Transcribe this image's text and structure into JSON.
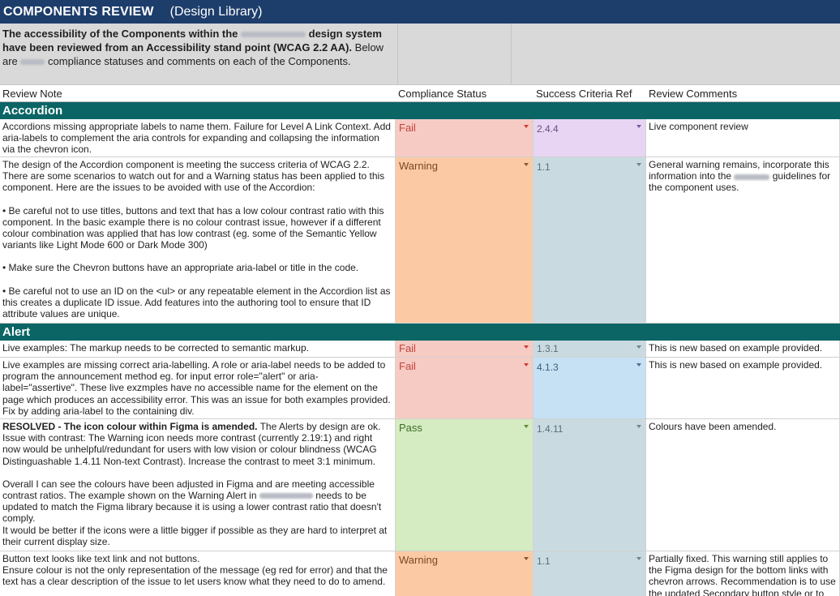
{
  "title": {
    "main": "COMPONENTS REVIEW",
    "sub": "(Design Library)"
  },
  "intro": {
    "bold1": "The accessibility of the Components within the",
    "bold2": "design system have been reviewed from an Accessibility stand point (WCAG 2.2 AA).",
    "text1": "Below are",
    "text2": "compliance statuses and comments on each of the Components."
  },
  "columns": {
    "note": "Review Note",
    "status": "Compliance Status",
    "criteria": "Success Criteria Ref",
    "comments": "Review Comments"
  },
  "sections": {
    "accordion": "Accordion",
    "alert": "Alert"
  },
  "rows": {
    "acc1": {
      "note": "Accordions missing appropriate labels to name them.  Failure for Level A Link Context. Add aria-labels to complement the aria controls for expanding and collapsing the information via the chevron icon.",
      "status": "Fail",
      "criteria": "2.4.4",
      "comment": "Live component review"
    },
    "acc2": {
      "note1": "The design of the Accordion component is meeting the success criteria of WCAG 2.2.  There are some scenarios to watch out for and a Warning status has been applied to this component.  Here are the issues to be avoided with use of the Accordion:",
      "note2": "• Be careful not to use titles, buttons and text that has a low colour contrast ratio with this component.  In the basic example there is no colour contrast issue, however if a different colour combination was applied that has low contrast (eg. some of the Semantic Yellow variants like Light Mode 600 or Dark Mode 300)",
      "note3": "• Make sure the Chevron buttons have an appropriate aria-label or title in the code.",
      "note4": "• Be careful not to use an ID on the <ul> or any repeatable element in the Accordion list as this creates a duplicate ID issue. Add features into the authoring tool to ensure that ID attribute values are unique.",
      "status": "Warning",
      "criteria": "1.1",
      "comment_a": "General warning remains, incorporate this information into the",
      "comment_b": "guidelines for the component uses."
    },
    "al1": {
      "note": "Live examples: The markup needs to be corrected to semantic markup.",
      "status": "Fail",
      "criteria": "1.3.1",
      "comment": "This is new based on example provided."
    },
    "al2": {
      "note": "Live examples are missing correct aria-labelling. A role or aria-label needs to be added to program the announcement method eg. for input error role=\"alert\" or aria-label=\"assertive\". These live exzmples have no accessible name for the element on the page which produces an accessibility error.  This was an issue for both examples provided. Fix by adding aria-label to the containing div.",
      "status": "Fail",
      "criteria": "4.1.3",
      "comment": "This is new based on example provided."
    },
    "al3": {
      "bold": "RESOLVED - The icon colour within Figma is amended.",
      "note1": " The Alerts by design are ok.",
      "note2": "Issue with contrast: The Warning icon needs more contrast (currently 2.19:1) and right now would be unhelpful/redundant for users with low vision or colour blindness (WCAG Distinguashable 1.4.11 Non-text Contrast).  Increase the contrast to meet 3:1 minimum.",
      "note3a": "Overall I can see the colours have been adjusted in Figma and are meeting accessible contrast ratios. The example shown on the Warning Alert in",
      "note3b": "needs to be updated to match the Figma library because it is using a lower contrast ratio that doesn't comply.",
      "note4": "It would be better if the icons were a little bigger if possible as they are hard to interpret at their current display size.",
      "status": "Pass",
      "criteria": "1.4.11",
      "comment": "Colours have been amended."
    },
    "al4": {
      "note1": "Button text looks like text link and not buttons.",
      "note2": "Ensure colour is not the only representation of the message (eg red for error) and that the text has a clear description of the issue to let users know what they need to do to amend.",
      "status": "Warning",
      "criteria": "1.1",
      "comment": "Partially fixed. This warning still applies to the Figma design for the bottom links with chevron arrows. Recommendation is to use the updated Secondary button style or to"
    }
  }
}
